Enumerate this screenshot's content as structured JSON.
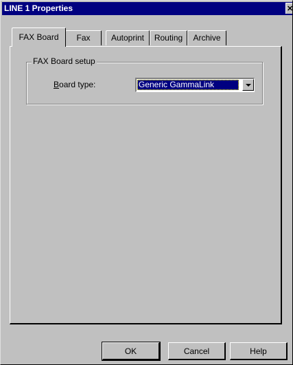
{
  "window": {
    "title": "LINE 1 Properties",
    "close_glyph": "✕"
  },
  "tabs": [
    {
      "label": "FAX Board",
      "active": true
    },
    {
      "label": "Fax",
      "active": false
    },
    {
      "label": "Autoprint",
      "active": false
    },
    {
      "label": "Routing",
      "active": false
    },
    {
      "label": "Archive",
      "active": false
    }
  ],
  "group": {
    "title": "FAX Board setup",
    "board_type_label_accel": "B",
    "board_type_label_rest": "oard type:",
    "board_type_value": "Generic GammaLink"
  },
  "buttons": {
    "ok": "OK",
    "cancel": "Cancel",
    "help": "Help"
  },
  "colors": {
    "titlebar": "#000080",
    "face": "#c0c0c0",
    "selection": "#000080"
  }
}
